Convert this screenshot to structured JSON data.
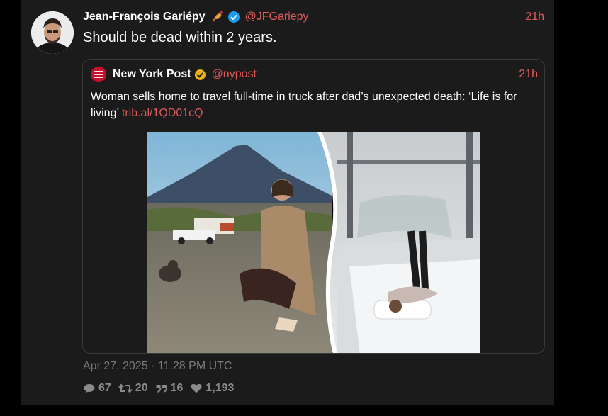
{
  "tweet": {
    "author_name": "Jean-François Gariépy",
    "author_handle": "@JFGariepy",
    "time": "21h",
    "text": "Should be dead within 2 years.",
    "date": "Apr 27, 2025 · 11:28 PM UTC",
    "stats": {
      "replies": "67",
      "retweets": "20",
      "quotes": "16",
      "likes": "1,193"
    }
  },
  "quote": {
    "author_name": "New York Post",
    "author_handle": "@nypost",
    "time": "21h",
    "text": "Woman sells home to travel full-time in truck after dad’s unexpected death: ‘Life is for living’",
    "link": "trib.al/1QD01cQ",
    "logo_text": "NEW YORK POST"
  },
  "icons": {
    "emoji": "candy-icon",
    "verified": "verified-badge-icon",
    "reply": "comment-icon",
    "retweet": "retweet-icon",
    "quote": "quote-icon",
    "like": "heart-icon"
  },
  "colors": {
    "accent": "#e05a5a",
    "panel": "#1b1b1b",
    "muted": "#7b7b7b"
  }
}
